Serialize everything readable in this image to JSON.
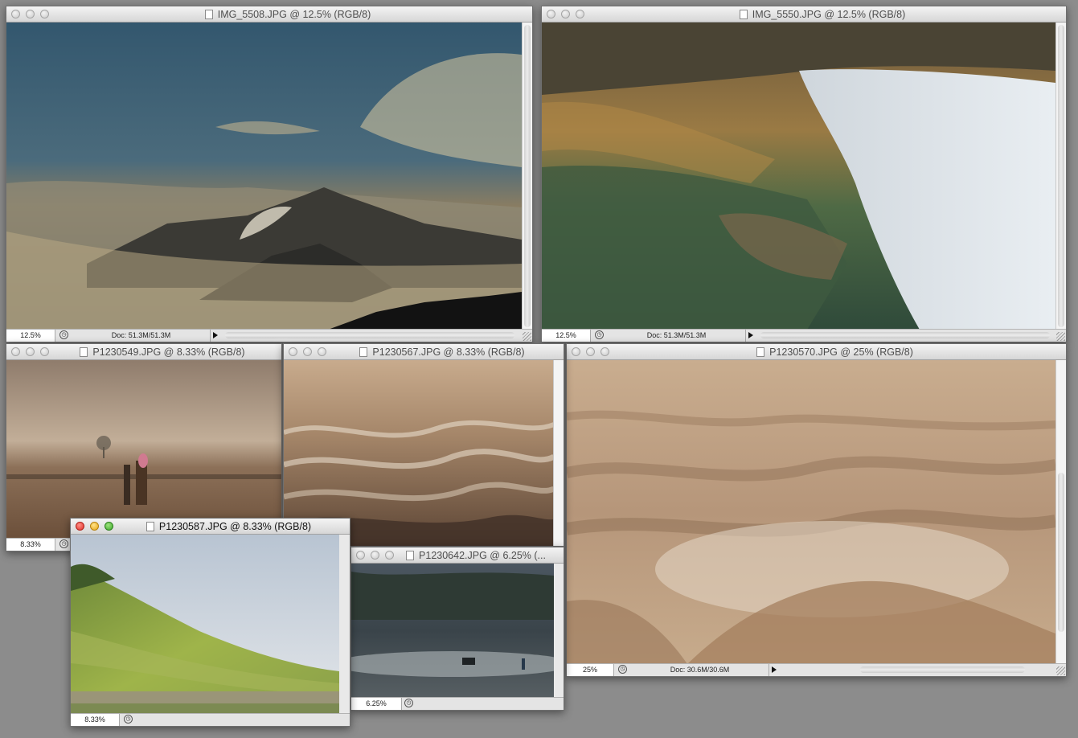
{
  "windows": {
    "w1": {
      "title": "IMG_5508.JPG @ 12.5% (RGB/8)",
      "zoom": "12.5%",
      "doc": "Doc: 51.3M/51.3M"
    },
    "w2": {
      "title": "IMG_5550.JPG @ 12.5% (RGB/8)",
      "zoom": "12.5%",
      "doc": "Doc: 51.3M/51.3M"
    },
    "w3": {
      "title": "P1230549.JPG @ 8.33% (RGB/8)",
      "zoom": "8.33%"
    },
    "w4": {
      "title": "P1230567.JPG @ 8.33% (RGB/8)"
    },
    "w5": {
      "title": "P1230570.JPG @ 25% (RGB/8)",
      "zoom": "25%",
      "doc": "Doc: 30.6M/30.6M"
    },
    "w6": {
      "title": "P1230642.JPG @ 6.25% (...",
      "zoom": "6.25%"
    },
    "w7": {
      "title": "P1230587.JPG @ 8.33% (RGB/8)",
      "zoom": "8.33%"
    }
  },
  "icons": {
    "window_controls": [
      "close-button",
      "minimize-button",
      "zoom-button"
    ],
    "status_bar": [
      "zoom-field",
      "info-popup-button",
      "status-menu-arrow",
      "resize-grip"
    ]
  },
  "colors": {
    "desktop": "#8c8c8c",
    "close_active": "#e0312a",
    "minimize_active": "#e7a614",
    "zoom_active": "#3da82a"
  }
}
